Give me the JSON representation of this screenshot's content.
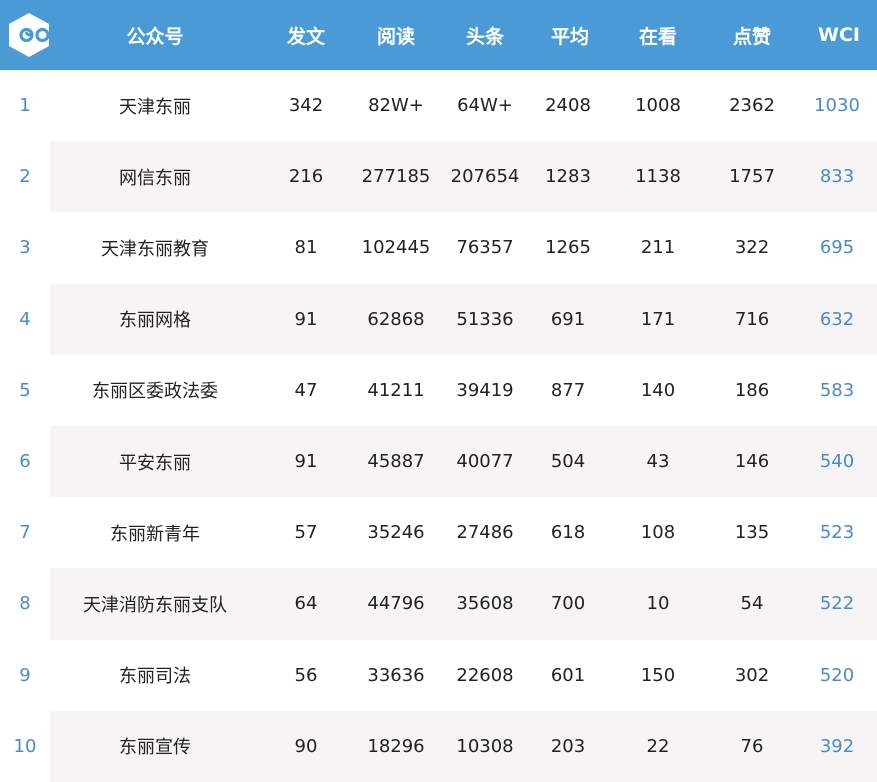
{
  "colors": {
    "header_bg": "#4a9ad6",
    "alt_row_bg": "#f7f4f5",
    "accent": "#4a8bc6"
  },
  "logo": {
    "icon": "infinity-hexagon-logo"
  },
  "columns": [
    "公众号",
    "发文",
    "阅读",
    "头条",
    "平均",
    "在看",
    "点赞",
    "WCI"
  ],
  "rows": [
    {
      "rank": "1",
      "name": "天津东丽",
      "posts": "342",
      "reads": "82W+",
      "headline": "64W+",
      "avg": "2408",
      "watching": "1008",
      "likes": "2362",
      "wci": "1030"
    },
    {
      "rank": "2",
      "name": "网信东丽",
      "posts": "216",
      "reads": "277185",
      "headline": "207654",
      "avg": "1283",
      "watching": "1138",
      "likes": "1757",
      "wci": "833"
    },
    {
      "rank": "3",
      "name": "天津东丽教育",
      "posts": "81",
      "reads": "102445",
      "headline": "76357",
      "avg": "1265",
      "watching": "211",
      "likes": "322",
      "wci": "695"
    },
    {
      "rank": "4",
      "name": "东丽网格",
      "posts": "91",
      "reads": "62868",
      "headline": "51336",
      "avg": "691",
      "watching": "171",
      "likes": "716",
      "wci": "632"
    },
    {
      "rank": "5",
      "name": "东丽区委政法委",
      "posts": "47",
      "reads": "41211",
      "headline": "39419",
      "avg": "877",
      "watching": "140",
      "likes": "186",
      "wci": "583"
    },
    {
      "rank": "6",
      "name": "平安东丽",
      "posts": "91",
      "reads": "45887",
      "headline": "40077",
      "avg": "504",
      "watching": "43",
      "likes": "146",
      "wci": "540"
    },
    {
      "rank": "7",
      "name": "东丽新青年",
      "posts": "57",
      "reads": "35246",
      "headline": "27486",
      "avg": "618",
      "watching": "108",
      "likes": "135",
      "wci": "523"
    },
    {
      "rank": "8",
      "name": "天津消防东丽支队",
      "posts": "64",
      "reads": "44796",
      "headline": "35608",
      "avg": "700",
      "watching": "10",
      "likes": "54",
      "wci": "522"
    },
    {
      "rank": "9",
      "name": "东丽司法",
      "posts": "56",
      "reads": "33636",
      "headline": "22608",
      "avg": "601",
      "watching": "150",
      "likes": "302",
      "wci": "520"
    },
    {
      "rank": "10",
      "name": "东丽宣传",
      "posts": "90",
      "reads": "18296",
      "headline": "10308",
      "avg": "203",
      "watching": "22",
      "likes": "76",
      "wci": "392"
    }
  ]
}
